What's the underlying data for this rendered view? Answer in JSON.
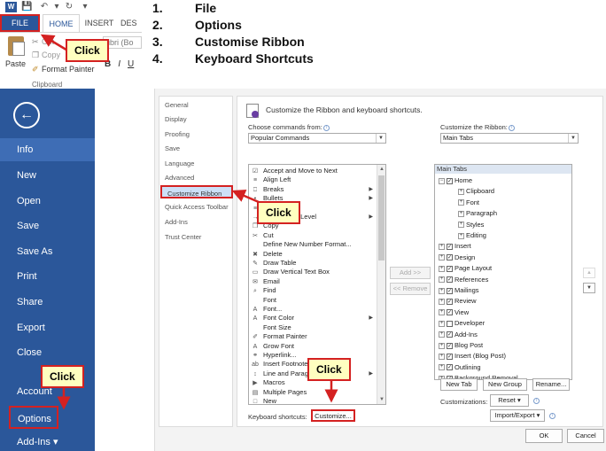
{
  "steps": [
    {
      "num": "1.",
      "text": "File"
    },
    {
      "num": "2.",
      "text": "Options"
    },
    {
      "num": "3.",
      "text": "Customise Ribbon"
    },
    {
      "num": "4.",
      "text": "Keyboard Shortcuts"
    }
  ],
  "ribbon": {
    "logo": "W",
    "tabs": {
      "file": "FILE",
      "home": "HOME",
      "insert": "INSERT",
      "des": "DES"
    },
    "paste": "Paste",
    "cut": "Cut",
    "copy": "Copy",
    "format_painter": "Format Painter",
    "group": "Clipboard",
    "font": "libri (Bo",
    "bold": "B",
    "italic": "I",
    "underline": "U"
  },
  "backstage": {
    "items": [
      "Info",
      "New",
      "Open",
      "Save",
      "Save As",
      "Print",
      "Share",
      "Export",
      "Close",
      "Account",
      "Options",
      "Add-Ins ▾"
    ]
  },
  "dialog": {
    "categories": [
      "General",
      "Display",
      "Proofing",
      "Save",
      "Language",
      "Advanced",
      "Customize Ribbon",
      "Quick Access Toolbar",
      "Add-Ins",
      "Trust Center"
    ],
    "header": "Customize the Ribbon and keyboard shortcuts.",
    "choose_label": "Choose commands from:",
    "choose_value": "Popular Commands",
    "customize_label": "Customize the Ribbon:",
    "customize_value": "Main Tabs",
    "commands": [
      {
        "label": "Accept and Move to Next",
        "icon": "☑",
        "sub": false
      },
      {
        "label": "Align Left",
        "icon": "≡",
        "sub": false
      },
      {
        "label": "Breaks",
        "icon": "⎕",
        "sub": true
      },
      {
        "label": "Bullets",
        "icon": "•",
        "sub": true
      },
      {
        "label": "Center",
        "icon": "≡",
        "sub": false
      },
      {
        "label": "Change List Level",
        "icon": "→",
        "sub": true
      },
      {
        "label": "Copy",
        "icon": "❐",
        "sub": false
      },
      {
        "label": "Cut",
        "icon": "✂",
        "sub": false
      },
      {
        "label": "Define New Number Format...",
        "icon": "",
        "sub": false
      },
      {
        "label": "Delete",
        "icon": "✖",
        "sub": false
      },
      {
        "label": "Draw Table",
        "icon": "✎",
        "sub": false
      },
      {
        "label": "Draw Vertical Text Box",
        "icon": "▭",
        "sub": false
      },
      {
        "label": "Email",
        "icon": "✉",
        "sub": false
      },
      {
        "label": "Find",
        "icon": "⌕",
        "sub": false
      },
      {
        "label": "Font",
        "icon": "",
        "sub": false
      },
      {
        "label": "Font...",
        "icon": "A",
        "sub": false
      },
      {
        "label": "Font Color",
        "icon": "A",
        "sub": true
      },
      {
        "label": "Font Size",
        "icon": "",
        "sub": false
      },
      {
        "label": "Format Painter",
        "icon": "✐",
        "sub": false
      },
      {
        "label": "Grow Font",
        "icon": "A",
        "sub": false
      },
      {
        "label": "Hyperlink...",
        "icon": "⚭",
        "sub": false
      },
      {
        "label": "Insert Footnote",
        "icon": "ab",
        "sub": false
      },
      {
        "label": "Line and Paragraph Spacing",
        "icon": "↕",
        "sub": true
      },
      {
        "label": "Macros",
        "icon": "▶",
        "sub": false
      },
      {
        "label": "Multiple Pages",
        "icon": "▤",
        "sub": false
      },
      {
        "label": "New",
        "icon": "□",
        "sub": false
      }
    ],
    "tree_header": "Main Tabs",
    "tree": [
      {
        "label": "Home",
        "level": 0,
        "exp": "−",
        "checked": true
      },
      {
        "label": "Clipboard",
        "level": 1,
        "exp": "+",
        "checked": null
      },
      {
        "label": "Font",
        "level": 1,
        "exp": "+",
        "checked": null
      },
      {
        "label": "Paragraph",
        "level": 1,
        "exp": "+",
        "checked": null
      },
      {
        "label": "Styles",
        "level": 1,
        "exp": "+",
        "checked": null
      },
      {
        "label": "Editing",
        "level": 1,
        "exp": "+",
        "checked": null
      },
      {
        "label": "Insert",
        "level": 0,
        "exp": "+",
        "checked": true
      },
      {
        "label": "Design",
        "level": 0,
        "exp": "+",
        "checked": true
      },
      {
        "label": "Page Layout",
        "level": 0,
        "exp": "+",
        "checked": true
      },
      {
        "label": "References",
        "level": 0,
        "exp": "+",
        "checked": true
      },
      {
        "label": "Mailings",
        "level": 0,
        "exp": "+",
        "checked": true
      },
      {
        "label": "Review",
        "level": 0,
        "exp": "+",
        "checked": true
      },
      {
        "label": "View",
        "level": 0,
        "exp": "+",
        "checked": true
      },
      {
        "label": "Developer",
        "level": 0,
        "exp": "+",
        "checked": false
      },
      {
        "label": "Add-Ins",
        "level": 0,
        "exp": "+",
        "checked": true
      },
      {
        "label": "Blog Post",
        "level": 0,
        "exp": "+",
        "checked": true
      },
      {
        "label": "Insert (Blog Post)",
        "level": 0,
        "exp": "+",
        "checked": true
      },
      {
        "label": "Outlining",
        "level": 0,
        "exp": "+",
        "checked": true
      },
      {
        "label": "Background Removal",
        "level": 0,
        "exp": "+",
        "checked": true
      }
    ],
    "add_button": "Add >>",
    "remove_button": "<< Remove",
    "new_tab": "New Tab",
    "new_group": "New Group",
    "rename": "Rename...",
    "customizations_label": "Customizations:",
    "reset": "Reset ▾",
    "import_export": "Import/Export ▾",
    "keyboard_label": "Keyboard shortcuts:",
    "customize_button": "Customize...",
    "ok": "OK",
    "cancel": "Cancel"
  },
  "callouts": [
    "Click",
    "Click",
    "Click",
    "Click"
  ],
  "colors": {
    "word_blue": "#2b579a",
    "highlight_red": "#d42121",
    "callout_yellow": "#ffffc0"
  }
}
